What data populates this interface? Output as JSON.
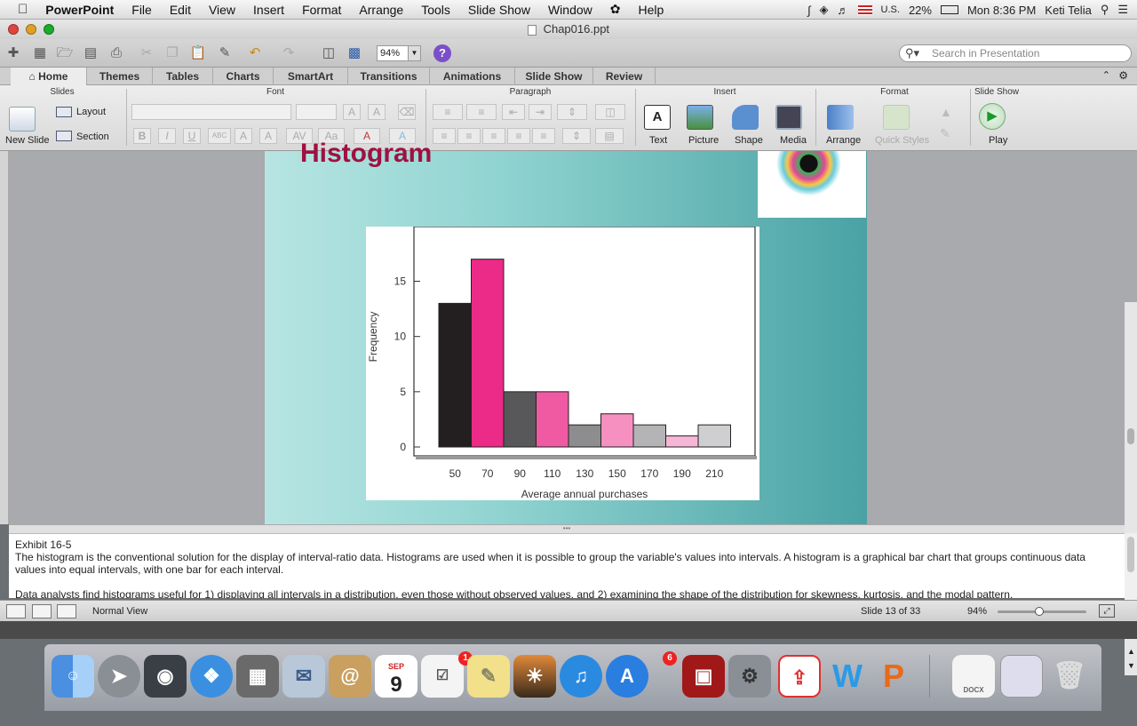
{
  "menubar": {
    "app_name": "PowerPoint",
    "menus": [
      "File",
      "Edit",
      "View",
      "Insert",
      "Format",
      "Arrange",
      "Tools",
      "Slide Show",
      "Window",
      "Help"
    ],
    "input_source": "U.S.",
    "battery": "22%",
    "clock": "Mon 8:36 PM",
    "user": "Keti Telia"
  },
  "window": {
    "title": "Chap016.ppt"
  },
  "toolbar": {
    "zoom": "94%",
    "search_placeholder": "Search in Presentation"
  },
  "tabs": [
    "Home",
    "Themes",
    "Tables",
    "Charts",
    "SmartArt",
    "Transitions",
    "Animations",
    "Slide Show",
    "Review"
  ],
  "ribbon": {
    "groups": {
      "slides": "Slides",
      "font": "Font",
      "paragraph": "Paragraph",
      "insert": "Insert",
      "format": "Format",
      "slideshow": "Slide Show"
    },
    "new_slide": "New Slide",
    "layout": "Layout",
    "section": "Section",
    "text": "Text",
    "picture": "Picture",
    "shape": "Shape",
    "media": "Media",
    "arrange": "Arrange",
    "quick_styles": "Quick Styles",
    "play": "Play"
  },
  "slide": {
    "title": "Histogram"
  },
  "chart_data": {
    "type": "bar",
    "categories": [
      "50",
      "70",
      "90",
      "110",
      "130",
      "150",
      "170",
      "190",
      "210"
    ],
    "values": [
      13,
      17,
      5,
      5,
      2,
      3,
      2,
      1,
      2
    ],
    "colors": [
      "#231f20",
      "#ec2a87",
      "#58585a",
      "#ef5aa2",
      "#8d8d8f",
      "#f590c1",
      "#b4b4b6",
      "#f6b6d6",
      "#cfcfd1"
    ],
    "xlabel": "Average annual purchases",
    "ylabel": "Frequency",
    "yticks": [
      0,
      5,
      10,
      15
    ],
    "ylim": [
      0,
      18.5
    ]
  },
  "notes": {
    "line1": "Exhibit 16-5",
    "line2": "The histogram is the conventional solution for the display of interval-ratio data. Histograms are used when it is possible to group the variable's values into intervals. A histogram is a graphical bar chart that groups continuous data values into equal intervals, with one bar for each interval.",
    "line3": "Data analysts find histograms useful for 1) displaying all intervals in a distribution, even those without observed values, and 2) examining the shape of the distribution for skewness, kurtosis, and the modal pattern."
  },
  "status": {
    "view": "Normal View",
    "slide_counter": "Slide 13 of 33",
    "zoom": "94%",
    "zoom_fraction": 0.47
  },
  "dock": {
    "calendar_month": "SEP",
    "calendar_day": "9",
    "reminders_badge": "1",
    "appstore_badge": "6",
    "docx_label": "DOCX"
  }
}
